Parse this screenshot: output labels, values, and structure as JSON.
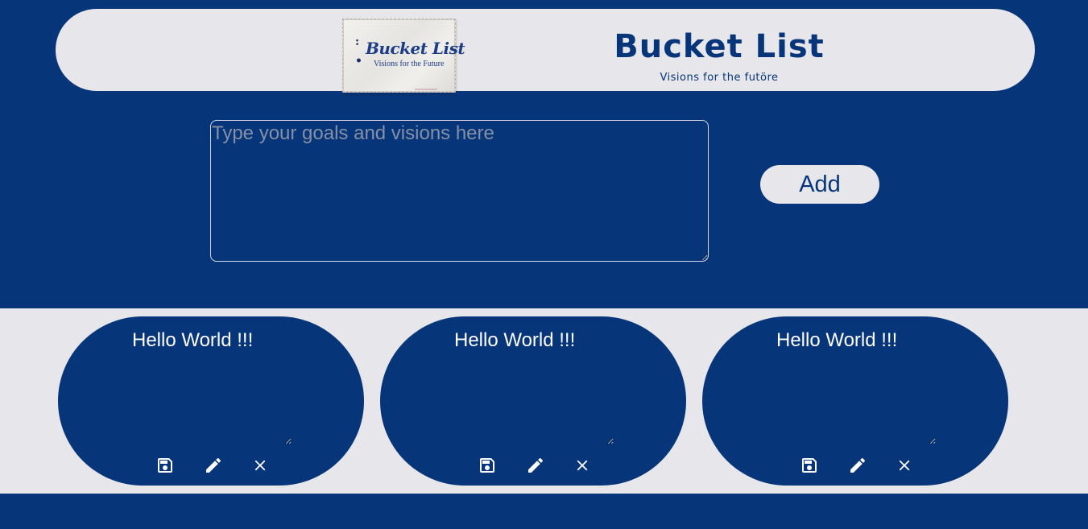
{
  "header": {
    "logo": {
      "title": "Bucket List",
      "subtitle": "Visions for the Future"
    },
    "title": "Bucket List",
    "subtitle": "Visions for the futöre"
  },
  "composer": {
    "placeholder": "Type your goals and visions here",
    "value": "",
    "add_label": "Add"
  },
  "cards": [
    {
      "text": "Hello World !!!",
      "actions": [
        "save-icon",
        "edit-icon",
        "close-icon"
      ]
    },
    {
      "text": "Hello World !!!",
      "actions": [
        "save-icon",
        "edit-icon",
        "close-icon"
      ]
    },
    {
      "text": "Hello World !!!",
      "actions": [
        "save-icon",
        "edit-icon",
        "close-icon"
      ]
    }
  ],
  "colors": {
    "primary": "#06357a",
    "surface": "#e7e6ea",
    "text_on_primary": "#ffffff"
  }
}
